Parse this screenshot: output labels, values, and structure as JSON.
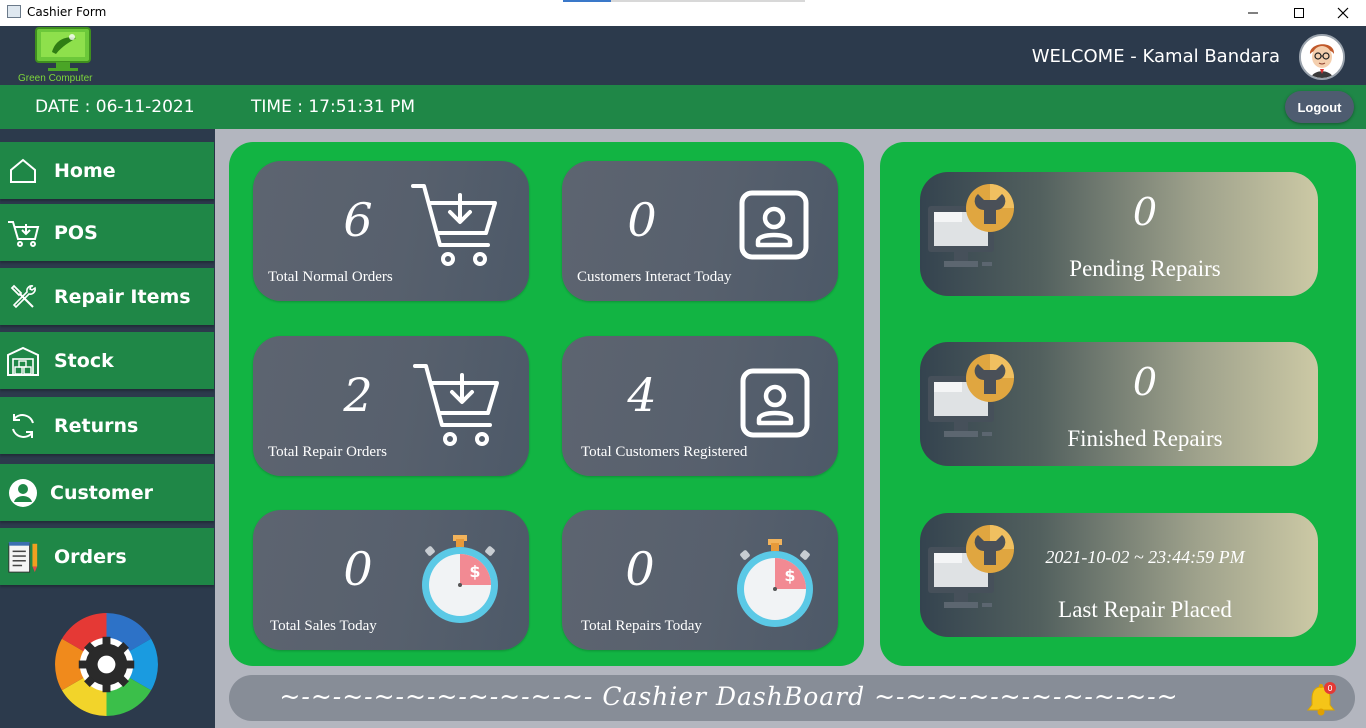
{
  "window": {
    "title": "Cashier Form"
  },
  "header": {
    "logo_text": "Green Computer",
    "welcome": "WELCOME - Kamal Bandara"
  },
  "datebar": {
    "date": "DATE : 06-11-2021",
    "time": "TIME : 17:51:31 PM",
    "logout_label": "Logout"
  },
  "sidebar": {
    "items": [
      {
        "label": "Home",
        "icon": "home-icon"
      },
      {
        "label": "POS",
        "icon": "cart-icon"
      },
      {
        "label": "Repair Items",
        "icon": "tools-icon"
      },
      {
        "label": "Stock",
        "icon": "warehouse-icon"
      },
      {
        "label": "Returns",
        "icon": "refresh-icon"
      },
      {
        "label": "Customer",
        "icon": "user-circle-icon"
      },
      {
        "label": "Orders",
        "icon": "notepad-icon"
      }
    ]
  },
  "stats": [
    {
      "value": "6",
      "label": "Total Normal Orders",
      "icon": "cart-download-icon"
    },
    {
      "value": "0",
      "label": "Customers Interact Today",
      "icon": "user-card-icon"
    },
    {
      "value": "2",
      "label": "Total Repair Orders",
      "icon": "cart-download-icon"
    },
    {
      "value": "4",
      "label": "Total Customers Registered",
      "icon": "user-card-icon"
    },
    {
      "value": "0",
      "label": "Total Sales Today",
      "icon": "stopwatch-icon"
    },
    {
      "value": "0",
      "label": "Total Repairs Today",
      "icon": "stopwatch-icon"
    }
  ],
  "repairs": [
    {
      "value": "0",
      "label": "Pending Repairs"
    },
    {
      "value": "0",
      "label": "Finished Repairs"
    },
    {
      "value": "2021-10-02 ~ 23:44:59 PM",
      "label": "Last Repair Placed"
    }
  ],
  "footer": {
    "text": "~-~-~-~-~-~-~-~-~-~- Cashier DashBoard ~-~-~-~-~-~-~-~-~-~",
    "notification_count": "0"
  },
  "colors": {
    "header_bg": "#2c3a4c",
    "green_bar": "#1f8747",
    "panel_green": "#12b443",
    "content_bg": "#b3b6bf"
  }
}
